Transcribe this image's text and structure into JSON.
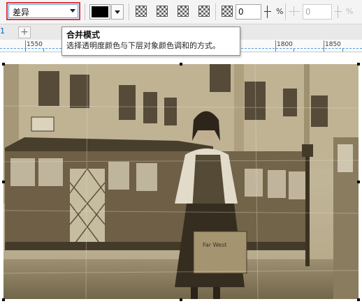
{
  "toolbar": {
    "blend_mode": {
      "value": "差异",
      "options_visible": [
        "差异"
      ]
    },
    "color": "#000000",
    "transparency": {
      "value": "0",
      "unit": "%"
    },
    "second_transparency": {
      "value": "0",
      "unit": "%"
    }
  },
  "tab": {
    "number": "1",
    "add": "+"
  },
  "ruler": {
    "labels": [
      "1550",
      "1600",
      "1800",
      "1850"
    ]
  },
  "tooltip": {
    "title": "合并模式",
    "description": "选择透明度颜色与下层对象颜色调和的方式。"
  },
  "photo": {
    "suitcase_text": "Far West"
  },
  "colors": {
    "highlight": "#e0353a",
    "dropdown_border": "#6a9fd6",
    "sepia_tone": "#8a7a5c"
  }
}
